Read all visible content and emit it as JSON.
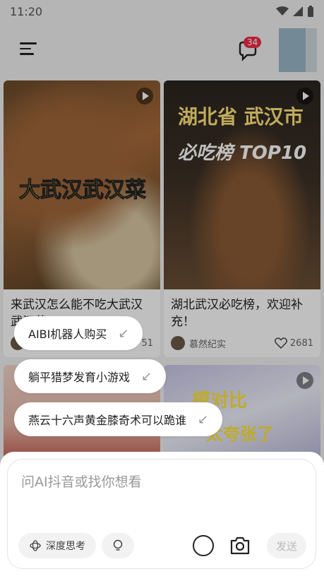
{
  "status": {
    "time": "11:20"
  },
  "header": {
    "notification_count": "34"
  },
  "feed": {
    "cards": [
      {
        "overlay": "大武汉武汉菜",
        "title": "来武汉怎么能不吃大武汉武汉菜",
        "author": "",
        "likes": "51"
      },
      {
        "overlay_line1": "湖北省 武汉市",
        "overlay_line2": "必吃榜 TOP10",
        "title": "湖北武汉必吃榜，欢迎补充！",
        "author": "慕然纪实",
        "likes": "2681"
      },
      {
        "overlay": ""
      },
      {
        "overlay_line1": "模对比",
        "overlay_line2": "太夸张了"
      }
    ]
  },
  "suggestions": [
    {
      "label": "AIBI机器人购买"
    },
    {
      "label": "躺平猎梦发育小游戏"
    },
    {
      "label": "燕云十六声黄金膝奇术可以跪谁"
    }
  ],
  "composer": {
    "placeholder": "问AI抖音或找你想看",
    "deep_think_label": "深度思考",
    "send_label": "发送"
  }
}
